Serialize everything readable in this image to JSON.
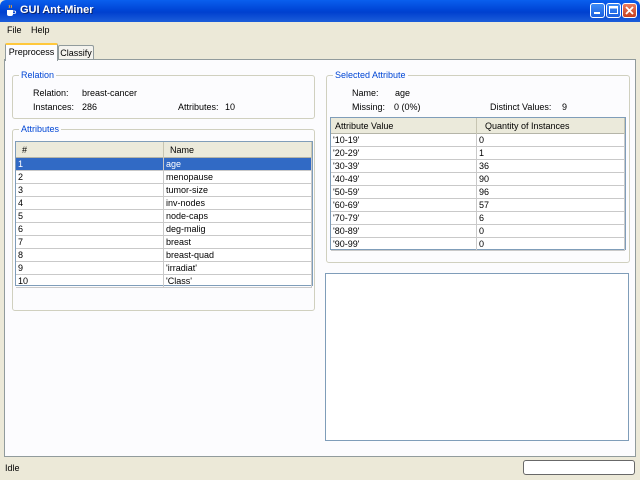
{
  "window": {
    "title": "GUI Ant-Miner"
  },
  "menu": {
    "items": [
      "File",
      "Help"
    ]
  },
  "tabs": [
    {
      "label": "Preprocess",
      "active": true
    },
    {
      "label": "Classify",
      "active": false
    }
  ],
  "relation": {
    "group_title": "Relation",
    "relation_label": "Relation:",
    "relation_value": "breast-cancer",
    "instances_label": "Instances:",
    "instances_value": "286",
    "attributes_label": "Attributes:",
    "attributes_value": "10"
  },
  "attributes": {
    "group_title": "Attributes",
    "columns": [
      "#",
      "Name"
    ],
    "rows": [
      {
        "num": "1",
        "name": "age",
        "selected": true
      },
      {
        "num": "2",
        "name": "menopause"
      },
      {
        "num": "3",
        "name": "tumor-size"
      },
      {
        "num": "4",
        "name": "inv-nodes"
      },
      {
        "num": "5",
        "name": "node-caps"
      },
      {
        "num": "6",
        "name": "deg-malig"
      },
      {
        "num": "7",
        "name": "breast"
      },
      {
        "num": "8",
        "name": "breast-quad"
      },
      {
        "num": "9",
        "name": "'irradiat'"
      },
      {
        "num": "10",
        "name": "'Class'"
      }
    ]
  },
  "selected_attribute": {
    "group_title": "Selected Attribute",
    "name_label": "Name:",
    "name_value": "age",
    "missing_label": "Missing:",
    "missing_value": "0 (0%)",
    "distinct_label": "Distinct Values:",
    "distinct_value": "9",
    "columns": [
      "Attribute Value",
      "Quantity of Instances"
    ],
    "rows": [
      {
        "value": "'10-19'",
        "qty": "0"
      },
      {
        "value": "'20-29'",
        "qty": "1"
      },
      {
        "value": "'30-39'",
        "qty": "36"
      },
      {
        "value": "'40-49'",
        "qty": "90"
      },
      {
        "value": "'50-59'",
        "qty": "96"
      },
      {
        "value": "'60-69'",
        "qty": "57"
      },
      {
        "value": "'70-79'",
        "qty": "6"
      },
      {
        "value": "'80-89'",
        "qty": "0"
      },
      {
        "value": "'90-99'",
        "qty": "0"
      }
    ]
  },
  "status": {
    "text": "Idle"
  },
  "colors": {
    "selection": "#316AC5",
    "group_title": "#0046D5",
    "titlebar": "#0045D6"
  }
}
